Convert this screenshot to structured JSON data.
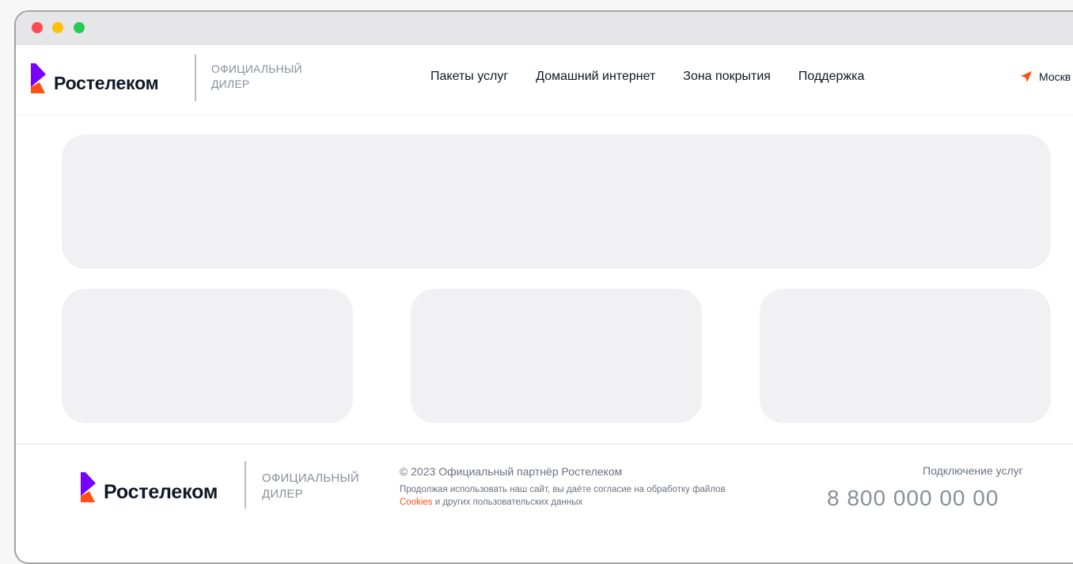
{
  "header": {
    "brand": "Ростелеком",
    "dealer_line1": "ОФИЦИАЛЬНЫЙ",
    "dealer_line2": "ДИЛЕР",
    "nav": [
      {
        "label": "Пакеты услуг"
      },
      {
        "label": "Домашний интернет"
      },
      {
        "label": "Зона покрытия"
      },
      {
        "label": "Поддержка"
      }
    ],
    "city": "Москв"
  },
  "footer": {
    "brand": "Ростелеком",
    "dealer_line1": "ОФИЦИАЛЬНЫЙ",
    "dealer_line2": "ДИЛЕР",
    "copyright": "© 2023 Официальный партнёр Ростелеком",
    "consent_before": "Продолжая использовать наш сайт, вы даёте согласие на обработку файлов",
    "consent_link": "Cookies",
    "consent_after": " и других пользовательских данных",
    "services_label": "Подключение услуг",
    "phone": "8 800 000 00 00"
  },
  "colors": {
    "brand_purple": "#7700ff",
    "brand_orange": "#ff4f12",
    "placeholder": "#f1f1f3"
  },
  "icons": {
    "location": "location-arrow-icon",
    "logo": "rostelecom-logo-icon"
  }
}
